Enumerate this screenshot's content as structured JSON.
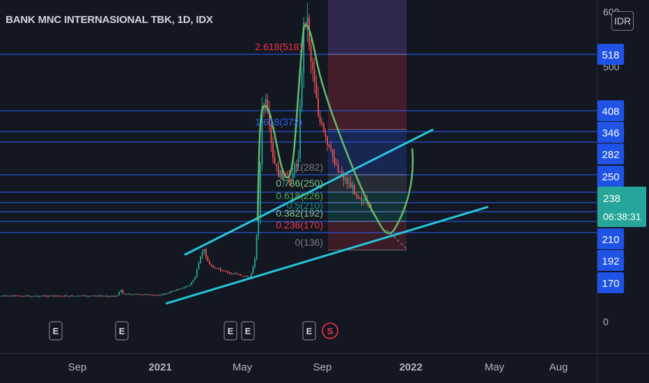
{
  "header": {
    "symbol_title": "BANK MNC INTERNASIONAL TBK, 1D, IDX",
    "currency_button": "IDR"
  },
  "price_axis": {
    "ticks": [
      "600",
      "500",
      "0"
    ],
    "level_labels": [
      "518",
      "408",
      "346",
      "282",
      "250",
      "210",
      "192",
      "170"
    ],
    "current_price": "238",
    "countdown": "06:38:31"
  },
  "time_axis": {
    "labels": [
      "Sep",
      "2021",
      "May",
      "Sep",
      "2022",
      "May",
      "Aug"
    ]
  },
  "fib_levels": [
    {
      "label": "2.618(518)",
      "value": 518,
      "color": "#f23645"
    },
    {
      "label": "1.618(372)",
      "value": 372,
      "color": "#2962ff"
    },
    {
      "label": "1(282)",
      "value": 282,
      "color": "#787b86"
    },
    {
      "label": "0.786(250)",
      "value": 250,
      "color": "#81c784"
    },
    {
      "label": "0.618(226)",
      "value": 226,
      "color": "#4caf50"
    },
    {
      "label": "0.5(210)",
      "value": 210,
      "color": "#089981"
    },
    {
      "label": "0.382(192)",
      "value": 192,
      "color": "#81c784"
    },
    {
      "label": "0.236(170)",
      "value": 170,
      "color": "#f23645"
    },
    {
      "label": "0(136)",
      "value": 136,
      "color": "#787b86"
    }
  ],
  "earnings_markers": [
    "E",
    "E",
    "E",
    "E",
    "E"
  ],
  "split_marker": "S",
  "colors": {
    "background": "#131722",
    "level_line": "#2962ff",
    "level_label_bg": "#1e53e5",
    "current_price_bg": "#26a69a",
    "trendline": "#26c6da",
    "pattern": "#66bb6a",
    "candle_up": "#26a69a",
    "candle_down": "#ef5350",
    "split": "#f23645"
  },
  "chart_data": {
    "type": "candlestick",
    "title": "BANK MNC INTERNASIONAL TBK, 1D, IDX",
    "xlabel": "",
    "ylabel": "",
    "ylim": [
      0,
      610
    ],
    "x_ticks": [
      "Sep",
      "2021",
      "May",
      "Sep",
      "2022",
      "May",
      "Aug"
    ],
    "horizontal_levels": [
      518,
      408,
      346,
      282,
      250,
      210,
      192,
      170
    ],
    "current_price": 238,
    "price_path": [
      {
        "t": "2020-07",
        "price": 50
      },
      {
        "t": "2020-10",
        "price": 52
      },
      {
        "t": "2020-11",
        "price": 52
      },
      {
        "t": "2021-01",
        "price": 51
      },
      {
        "t": "2021-02",
        "price": 100
      },
      {
        "t": "2021-03",
        "price": 88
      },
      {
        "t": "2021-04",
        "price": 90
      },
      {
        "t": "2021-05",
        "price": 104
      },
      {
        "t": "2021-06",
        "price": 400
      },
      {
        "t": "2021-07",
        "price": 265
      },
      {
        "t": "2021-08",
        "price": 550
      },
      {
        "t": "2021-09",
        "price": 340
      },
      {
        "t": "2021-10",
        "price": 275
      },
      {
        "t": "2021-11",
        "price": 238
      }
    ],
    "grid": false,
    "legend": "none"
  }
}
